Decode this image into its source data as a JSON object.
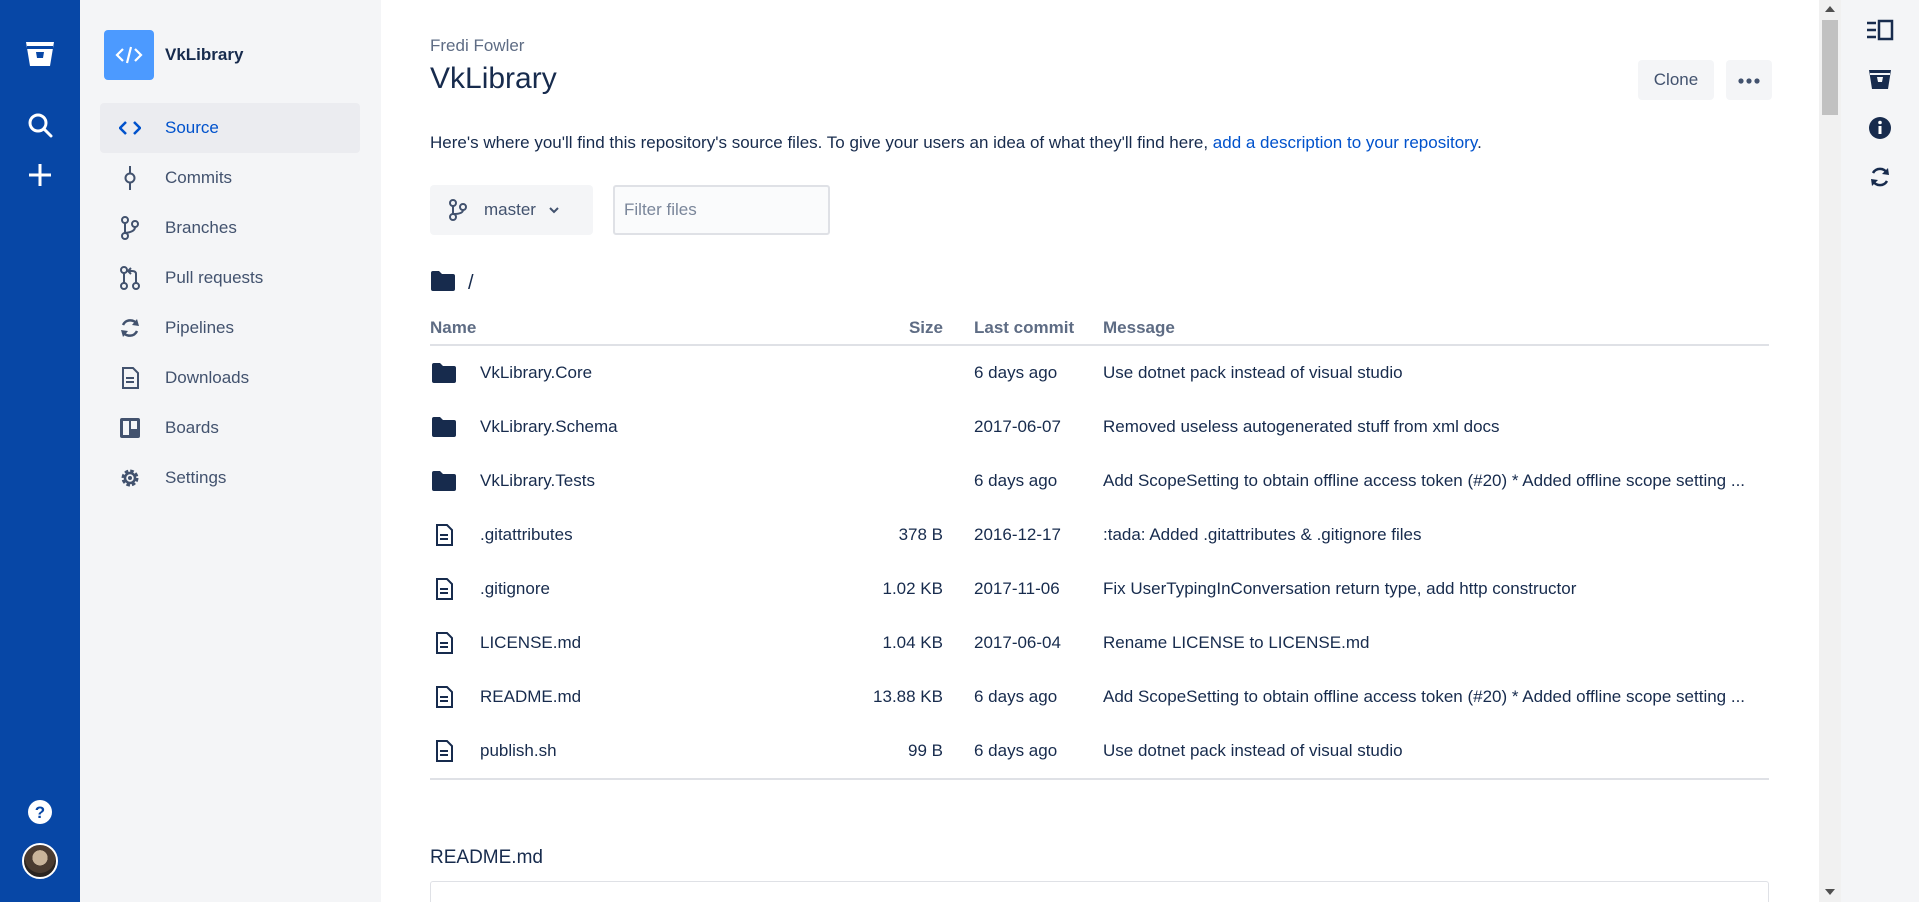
{
  "global_nav": {
    "icons": [
      "bitbucket-logo-icon",
      "search-icon",
      "create-plus-icon",
      "help-icon",
      "user-avatar"
    ]
  },
  "sidebar": {
    "repo_name": "VkLibrary",
    "items": [
      {
        "label": "Source",
        "icon": "source-code-icon",
        "active": true
      },
      {
        "label": "Commits",
        "icon": "commit-icon"
      },
      {
        "label": "Branches",
        "icon": "branch-icon"
      },
      {
        "label": "Pull requests",
        "icon": "pull-request-icon"
      },
      {
        "label": "Pipelines",
        "icon": "pipelines-icon"
      },
      {
        "label": "Downloads",
        "icon": "downloads-icon"
      },
      {
        "label": "Boards",
        "icon": "boards-icon"
      },
      {
        "label": "Settings",
        "icon": "settings-icon"
      }
    ]
  },
  "header": {
    "owner": "Fredi Fowler",
    "title": "VkLibrary",
    "clone_label": "Clone"
  },
  "description": {
    "text": "Here's where you'll find this repository's source files. To give your users an idea of what they'll find here, ",
    "link": "add a description to your repository",
    "suffix": "."
  },
  "toolbar": {
    "branch": "master",
    "filter_placeholder": "Filter files"
  },
  "path": "/",
  "table": {
    "columns": {
      "name": "Name",
      "size": "Size",
      "last_commit": "Last commit",
      "message": "Message"
    },
    "rows": [
      {
        "type": "folder",
        "name": "VkLibrary.Core",
        "size": "",
        "last_commit": "6 days ago",
        "message": "Use dotnet pack instead of visual studio"
      },
      {
        "type": "folder",
        "name": "VkLibrary.Schema",
        "size": "",
        "last_commit": "2017-06-07",
        "message": "Removed useless autogenerated stuff from xml docs"
      },
      {
        "type": "folder",
        "name": "VkLibrary.Tests",
        "size": "",
        "last_commit": "6 days ago",
        "message": "Add ScopeSetting to obtain offline access token (#20) * Added offline scope setting ..."
      },
      {
        "type": "file",
        "name": ".gitattributes",
        "size": "378 B",
        "last_commit": "2016-12-17",
        "message": ":tada: Added .gitattributes & .gitignore files"
      },
      {
        "type": "file",
        "name": ".gitignore",
        "size": "1.02 KB",
        "last_commit": "2017-11-06",
        "message": "Fix UserTypingInConversation return type, add http constructor"
      },
      {
        "type": "file",
        "name": "LICENSE.md",
        "size": "1.04 KB",
        "last_commit": "2017-06-04",
        "message": "Rename LICENSE to LICENSE.md"
      },
      {
        "type": "file",
        "name": "README.md",
        "size": "13.88 KB",
        "last_commit": "6 days ago",
        "message": "Add ScopeSetting to obtain offline access token (#20) * Added offline scope setting ..."
      },
      {
        "type": "file",
        "name": "publish.sh",
        "size": "99 B",
        "last_commit": "6 days ago",
        "message": "Use dotnet pack instead of visual studio"
      }
    ]
  },
  "readme": {
    "title": "README.md"
  },
  "right_rail": {
    "icons": [
      "sidebar-toggle-icon",
      "bitbucket-repo-icon",
      "info-icon",
      "sync-icon"
    ]
  },
  "colors": {
    "nav_bg": "#0747a6",
    "sidebar_bg": "#f4f5f7",
    "link": "#0052cc",
    "text": "#172b4d",
    "accent_avatar": "#4c9aff"
  }
}
